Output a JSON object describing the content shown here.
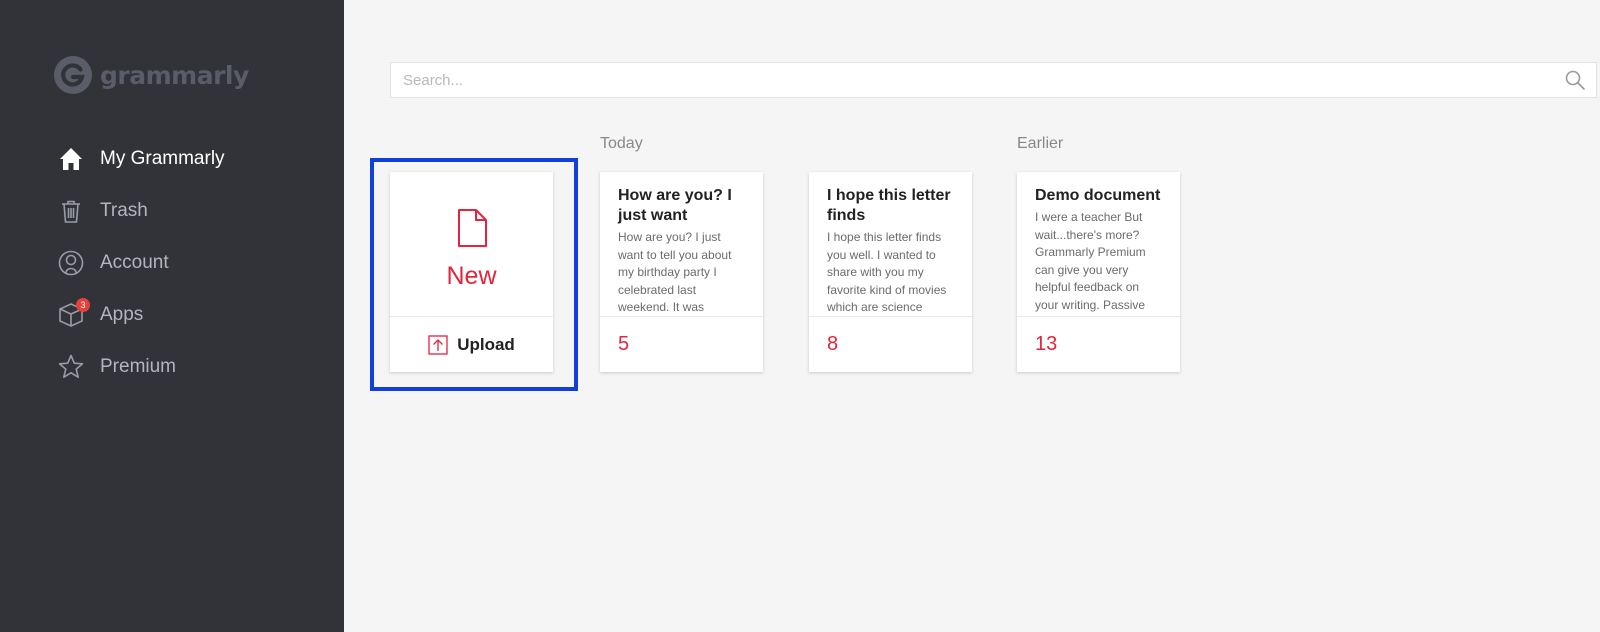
{
  "app": {
    "logo_text": "grammarly"
  },
  "sidebar": {
    "items": [
      {
        "label": "My Grammarly",
        "icon": "home-icon"
      },
      {
        "label": "Trash",
        "icon": "trash-icon"
      },
      {
        "label": "Account",
        "icon": "account-icon"
      },
      {
        "label": "Apps",
        "icon": "apps-icon",
        "badge": "3"
      },
      {
        "label": "Premium",
        "icon": "star-icon"
      }
    ]
  },
  "search": {
    "placeholder": "Search..."
  },
  "groups": {
    "today": "Today",
    "earlier": "Earlier"
  },
  "new_card": {
    "new_label": "New",
    "upload_label": "Upload"
  },
  "documents": [
    {
      "title": "How are you? I just want",
      "preview": "How are you? I just want to tell you about my birthday party I celebrated last weekend. It was",
      "count": "5"
    },
    {
      "title": "I hope this letter finds",
      "preview": "I hope this letter finds you well. I wanted to share with you my favorite kind of movies which are science",
      "count": "8"
    },
    {
      "title": "Demo document",
      "preview": "I were a teacher But wait...there's more? Grammarly Premium can give you very helpful feedback on your writing. Passive",
      "count": "13"
    }
  ],
  "colors": {
    "sidebar_bg": "#323338",
    "accent": "#e5243b",
    "highlight": "#1140d8",
    "badge": "#e5413b"
  }
}
